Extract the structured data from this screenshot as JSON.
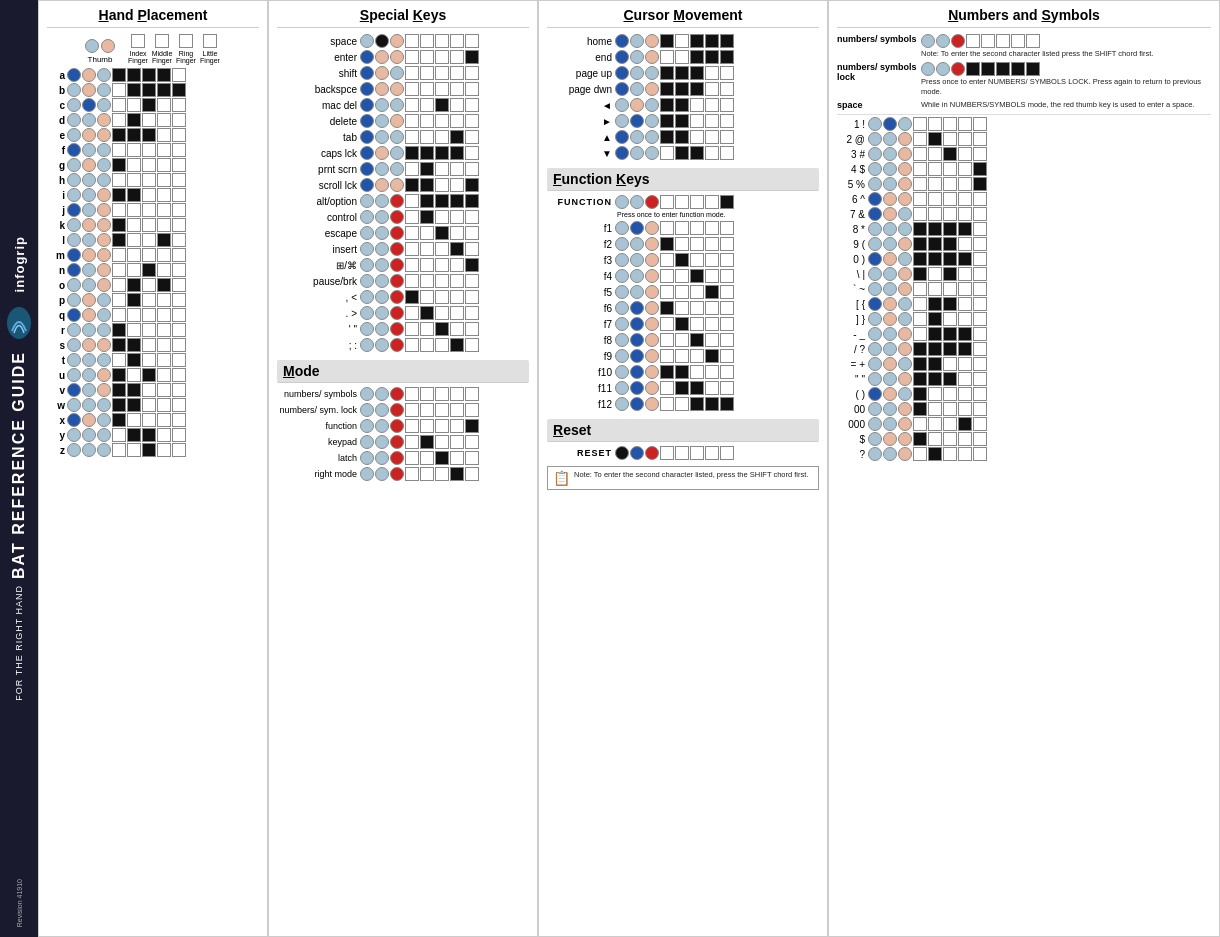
{
  "sidebar": {
    "brand": "infogrip",
    "title": "BAT REFERENCE GUIDE",
    "sub": "FOR THE RIGHT HAND",
    "revision": "Revision 41910"
  },
  "hand_placement": {
    "title": "Hand Placement",
    "fingers": {
      "thumb": "Thumb",
      "index": "Index Finger",
      "middle": "Middle Finger",
      "ring": "Ring Finger",
      "little": "Little Finger"
    },
    "keys": [
      {
        "label": "a",
        "chord": [
          "db",
          "p",
          "b",
          "K",
          "K",
          "K",
          "K",
          "w"
        ]
      },
      {
        "label": "b",
        "chord": [
          "b",
          "p",
          "b",
          "w",
          "K",
          "K",
          "K",
          "K"
        ]
      },
      {
        "label": "c",
        "chord": [
          "b",
          "db",
          "b",
          "w",
          "w",
          "K",
          "w",
          "w"
        ]
      },
      {
        "label": "d",
        "chord": [
          "b",
          "b",
          "p",
          "w",
          "K",
          "w",
          "w",
          "w"
        ]
      },
      {
        "label": "e",
        "chord": [
          "b",
          "p",
          "p",
          "K",
          "K",
          "K",
          "w",
          "w"
        ]
      },
      {
        "label": "f",
        "chord": [
          "db",
          "b",
          "b",
          "w",
          "w",
          "w",
          "w",
          "w"
        ]
      },
      {
        "label": "g",
        "chord": [
          "b",
          "p",
          "b",
          "K",
          "w",
          "w",
          "w",
          "w"
        ]
      },
      {
        "label": "h",
        "chord": [
          "b",
          "b",
          "b",
          "w",
          "w",
          "w",
          "w",
          "w"
        ]
      },
      {
        "label": "i",
        "chord": [
          "b",
          "b",
          "p",
          "K",
          "K",
          "w",
          "w",
          "w"
        ]
      },
      {
        "label": "j",
        "chord": [
          "db",
          "b",
          "p",
          "w",
          "w",
          "w",
          "w",
          "w"
        ]
      },
      {
        "label": "k",
        "chord": [
          "b",
          "p",
          "p",
          "K",
          "w",
          "w",
          "w",
          "w"
        ]
      },
      {
        "label": "l",
        "chord": [
          "b",
          "b",
          "p",
          "K",
          "w",
          "w",
          "K",
          "w"
        ]
      },
      {
        "label": "m",
        "chord": [
          "db",
          "p",
          "p",
          "w",
          "w",
          "w",
          "w",
          "w"
        ]
      },
      {
        "label": "n",
        "chord": [
          "db",
          "b",
          "p",
          "w",
          "w",
          "K",
          "w",
          "w"
        ]
      },
      {
        "label": "o",
        "chord": [
          "b",
          "b",
          "p",
          "w",
          "K",
          "w",
          "K",
          "w"
        ]
      },
      {
        "label": "p",
        "chord": [
          "b",
          "p",
          "b",
          "w",
          "K",
          "w",
          "w",
          "w"
        ]
      },
      {
        "label": "q",
        "chord": [
          "db",
          "p",
          "b",
          "w",
          "w",
          "w",
          "w",
          "w"
        ]
      },
      {
        "label": "r",
        "chord": [
          "b",
          "b",
          "b",
          "K",
          "w",
          "w",
          "w",
          "w"
        ]
      },
      {
        "label": "s",
        "chord": [
          "b",
          "p",
          "p",
          "K",
          "K",
          "w",
          "w",
          "w"
        ]
      },
      {
        "label": "t",
        "chord": [
          "b",
          "b",
          "b",
          "w",
          "K",
          "w",
          "w",
          "w"
        ]
      },
      {
        "label": "u",
        "chord": [
          "b",
          "b",
          "p",
          "K",
          "w",
          "K",
          "w",
          "w"
        ]
      },
      {
        "label": "v",
        "chord": [
          "db",
          "b",
          "p",
          "K",
          "K",
          "w",
          "w",
          "w"
        ]
      },
      {
        "label": "w",
        "chord": [
          "b",
          "b",
          "b",
          "K",
          "K",
          "w",
          "w",
          "w"
        ]
      },
      {
        "label": "x",
        "chord": [
          "db",
          "p",
          "b",
          "K",
          "w",
          "w",
          "w",
          "w"
        ]
      },
      {
        "label": "y",
        "chord": [
          "b",
          "b",
          "b",
          "w",
          "K",
          "K",
          "w",
          "w"
        ]
      },
      {
        "label": "z",
        "chord": [
          "b",
          "b",
          "b",
          "w",
          "w",
          "K",
          "w",
          "w"
        ]
      }
    ]
  },
  "special_keys": {
    "title": "Special Keys",
    "keys": [
      {
        "label": "space"
      },
      {
        "label": "enter"
      },
      {
        "label": "shift"
      },
      {
        "label": "backspce"
      },
      {
        "label": "mac del"
      },
      {
        "label": "delete"
      },
      {
        "label": "tab"
      },
      {
        "label": "caps lck"
      },
      {
        "label": "prnt scrn"
      },
      {
        "label": "scroll lck"
      },
      {
        "label": "alt/option"
      },
      {
        "label": "control"
      },
      {
        "label": "escape"
      },
      {
        "label": "insert"
      },
      {
        "label": "⊞/⌘"
      },
      {
        "label": "pause/brk"
      },
      {
        "label": ", <"
      },
      {
        "label": ". >"
      },
      {
        "label": "' \""
      },
      {
        "label": "; :"
      }
    ]
  },
  "cursor_movement": {
    "title": "Cursor Movement",
    "keys": [
      {
        "label": "home"
      },
      {
        "label": "end"
      },
      {
        "label": "page up"
      },
      {
        "label": "page dwn"
      },
      {
        "label": "◄"
      },
      {
        "label": "►"
      },
      {
        "label": "▲"
      },
      {
        "label": "▼"
      }
    ]
  },
  "numbers_symbols": {
    "title": "Numbers and Symbols",
    "note1": "Note: To enter the second character listed press the SHIFT chord first.",
    "note2": "Press once to enter NUMBERS/ SYMBOLS LOCK. Press again to return to previous mode.",
    "note3": "While in NUMBERS/SYMBOLS mode, the red thumb key is used to enter a space.",
    "keys": [
      {
        "label": "1 !"
      },
      {
        "label": "2 @"
      },
      {
        "label": "3 #"
      },
      {
        "label": "4 $"
      },
      {
        "label": "5 %"
      },
      {
        "label": "6 ^"
      },
      {
        "label": "7 &"
      },
      {
        "label": "8 *"
      },
      {
        "label": "9 ("
      },
      {
        "label": "0 )"
      },
      {
        "label": "\\ |"
      },
      {
        "label": "` ~"
      },
      {
        "label": "[ {"
      },
      {
        "label": "] }"
      },
      {
        "label": "- _"
      },
      {
        "label": "/ ?"
      },
      {
        "label": "= +"
      },
      {
        "label": "\" \""
      },
      {
        "label": "( )"
      },
      {
        "label": "00"
      },
      {
        "label": "000"
      },
      {
        "label": "$"
      },
      {
        "label": "?"
      }
    ]
  },
  "mode": {
    "title": "Mode",
    "keys": [
      {
        "label": "numbers/ symbols"
      },
      {
        "label": "numbers/ sym. lock"
      },
      {
        "label": "function"
      },
      {
        "label": "keypad"
      },
      {
        "label": "latch"
      },
      {
        "label": "right mode"
      }
    ]
  },
  "function_keys": {
    "title": "Function Keys",
    "function_label": "FUNCTION",
    "function_note": "Press once to enter function mode.",
    "keys": [
      {
        "label": "f1"
      },
      {
        "label": "f2"
      },
      {
        "label": "f3"
      },
      {
        "label": "f4"
      },
      {
        "label": "f5"
      },
      {
        "label": "f6"
      },
      {
        "label": "f7"
      },
      {
        "label": "f8"
      },
      {
        "label": "f9"
      },
      {
        "label": "f10"
      },
      {
        "label": "f11"
      },
      {
        "label": "f12"
      }
    ]
  },
  "reset": {
    "title": "Reset",
    "label": "RESET",
    "note": "Note: To enter the second character listed, press the SHIFT chord first."
  }
}
